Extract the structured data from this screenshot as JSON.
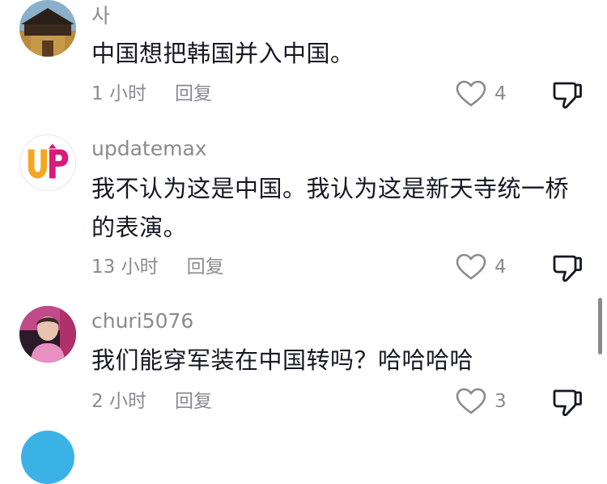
{
  "comments": [
    {
      "username": "사",
      "text": "中国想把韩国并入中国。",
      "time": "1 小时",
      "reply_label": "回复",
      "likes": "4",
      "avatar_icon": "fortress-gate-photo"
    },
    {
      "username": "updatemax",
      "text": "我不认为这是中国。我认为这是新天寺统一桥的表演。",
      "time": "13 小时",
      "reply_label": "回复",
      "likes": "4",
      "avatar_icon": "up-logo",
      "avatar_text": "UP"
    },
    {
      "username": "churi5076",
      "text": "我们能穿军装在中国转吗？哈哈哈哈",
      "time": "2 小时",
      "reply_label": "回复",
      "likes": "3",
      "avatar_icon": "person-photo"
    }
  ],
  "colors": {
    "text_primary": "#161823",
    "text_secondary": "#8a8b91",
    "up_orange": "#f5a623",
    "up_pink": "#d81b7c"
  }
}
